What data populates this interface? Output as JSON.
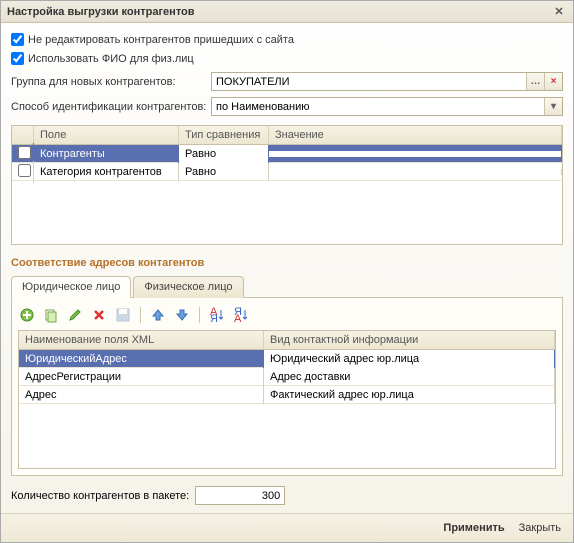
{
  "title": "Настройка выгрузки контрагентов",
  "checks": {
    "no_edit": "Не редактировать контрагентов пришедших с сайта",
    "use_fio": "Использовать ФИО для физ.лиц"
  },
  "group_label": "Группа для новых контрагентов:",
  "group_value": "ПОКУПАТЕЛИ",
  "ident_label": "Способ идентификации контрагентов:",
  "ident_value": "по Наименованию",
  "grid1": {
    "headers": {
      "field": "Поле",
      "comp": "Тип сравнения",
      "val": "Значение"
    },
    "rows": [
      {
        "field": "Контрагенты",
        "comp": "Равно",
        "val": ""
      },
      {
        "field": "Категория контрагентов",
        "comp": "Равно",
        "val": ""
      }
    ]
  },
  "section": "Соответствие адресов контагентов",
  "tabs": {
    "legal": "Юридическое лицо",
    "person": "Физическое лицо"
  },
  "grid2": {
    "headers": {
      "xml": "Наименование поля XML",
      "info": "Вид контактной информации"
    },
    "rows": [
      {
        "xml": "ЮридическийАдрес",
        "info": "Юридический адрес юр.лица"
      },
      {
        "xml": "АдресРегистрации",
        "info": "Адрес доставки"
      },
      {
        "xml": "Адрес",
        "info": "Фактический адрес юр.лица"
      }
    ]
  },
  "batch_label": "Количество контрагентов в пакете:",
  "batch_value": "300",
  "footer": {
    "apply": "Применить",
    "close": "Закрыть"
  }
}
